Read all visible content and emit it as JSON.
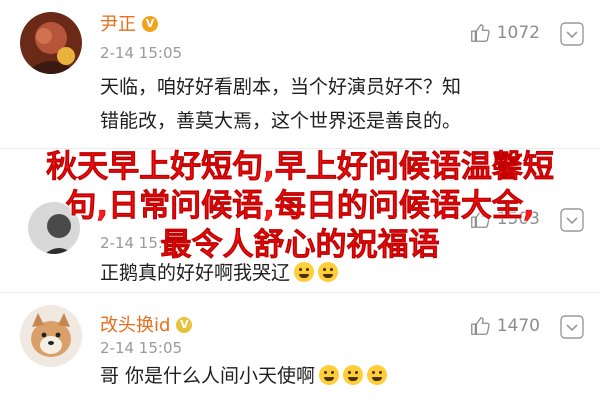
{
  "comments": [
    {
      "username": "尹正",
      "time": "2-14 15:05",
      "likes": "1072",
      "lines": [
        "天临，咱好好看剧本，当个好演员好不？知",
        "错能改，善莫大焉，这个世界还是善良的。"
      ],
      "emoji_count": 0
    },
    {
      "username": "",
      "time": "2-14 15:05",
      "likes": "1503",
      "lines": [
        "正鹅真的好好啊我哭辽"
      ],
      "emoji_count": 2
    },
    {
      "username": "改头换id",
      "time": "2-14 15:05",
      "likes": "1470",
      "lines": [
        "哥 你是什么人间小天使啊"
      ],
      "emoji_count": 3
    }
  ],
  "overlay": {
    "lines": [
      "秋天早上好短句,早上好问候语温馨短",
      "句,日常问候语,每日的问候语大全,",
      "最令人舒心的祝福语"
    ],
    "color": "#ff1a1a"
  },
  "icons": [
    "thumbs-up-icon",
    "chevron-down-icon",
    "verified-badge-icon",
    "crying-emoji-icon"
  ]
}
